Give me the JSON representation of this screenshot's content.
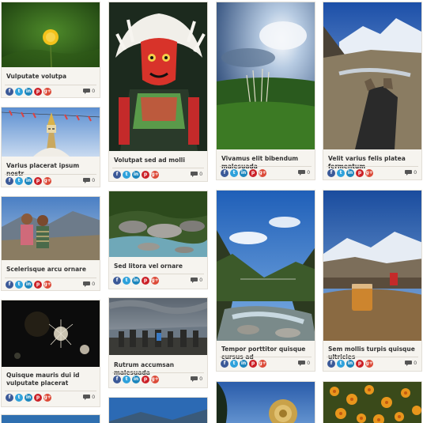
{
  "colors": {
    "card_bg": "#f6f4ef",
    "facebook": "#3b5998",
    "twitter": "#2ea1db",
    "linkedin": "#1c86bd",
    "pinterest": "#cb2027",
    "googleplus": "#dc4a38"
  },
  "share_icons": [
    "facebook-icon",
    "twitter-icon",
    "linkedin-icon",
    "pinterest-icon",
    "google-plus-icon"
  ],
  "share_glyphs": {
    "fb": "f",
    "tw": "t",
    "li": "in",
    "pi": "p",
    "gp": "g+"
  },
  "posts": [
    {
      "title": "Vulputate volutpa",
      "comments": "0"
    },
    {
      "title": "Volutpat sed ad molli",
      "comments": "0"
    },
    {
      "title": "Vivamus elit bibendum malesuada",
      "comments": "0"
    },
    {
      "title": "Velit varius felis platea fermentum",
      "comments": "0"
    },
    {
      "title": "Varius placerat ipsum nostr",
      "comments": "0"
    },
    {
      "title": "Sed litora vel ornare",
      "comments": "0"
    },
    {
      "title": "Scelerisque arcu ornare",
      "comments": "0"
    },
    {
      "title": "Tempor porttitor quisque cursus ad",
      "comments": "0"
    },
    {
      "title": "Sem mollis turpis quisque ultricies",
      "comments": "0"
    },
    {
      "title": "Quisque mauris dui id vulputate placerat",
      "comments": "0"
    },
    {
      "title": "Rutrum accumsan malesuada",
      "comments": "0"
    }
  ]
}
